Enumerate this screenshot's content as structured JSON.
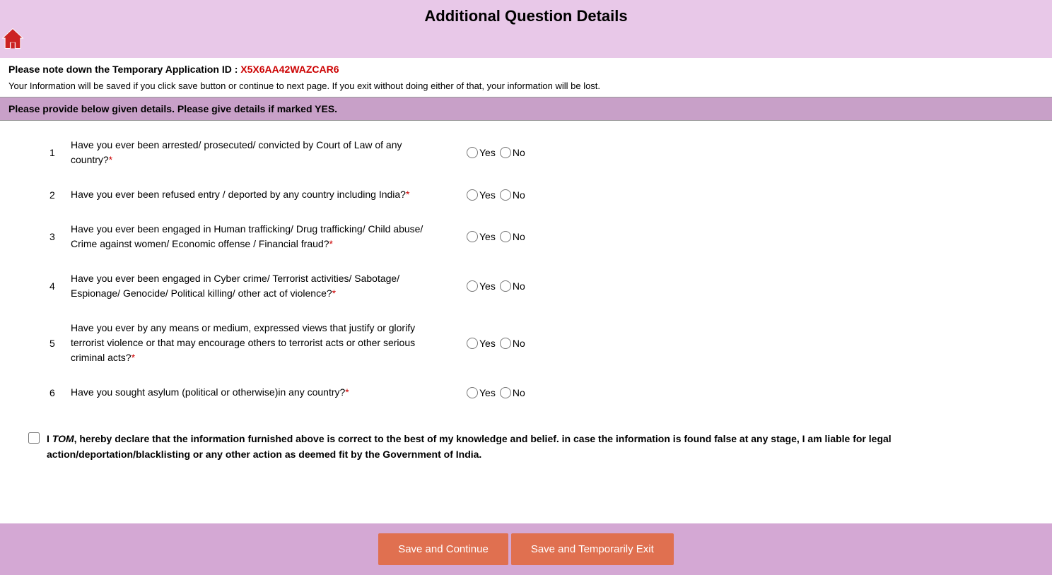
{
  "header": {
    "title": "Additional Question Details",
    "home_icon_label": "home"
  },
  "app_id_section": {
    "label": "Please note down the Temporary Application ID :",
    "value": "X5X6AA42WAZCAR6"
  },
  "info_text": "Your Information will be saved if you click save button or continue to next page. If you exit without doing either of that, your information will be lost.",
  "section_header": "Please provide below given details. Please give details if marked YES.",
  "questions": [
    {
      "number": "1",
      "text": "Have you ever been arrested/ prosecuted/ convicted by Court of Law of any country?",
      "required": true,
      "yes_label": "Yes",
      "no_label": "No",
      "name": "q1"
    },
    {
      "number": "2",
      "text": "Have you ever been refused entry / deported by any country including India?",
      "required": true,
      "yes_label": "Yes",
      "no_label": "No",
      "name": "q2"
    },
    {
      "number": "3",
      "text": "Have you ever been engaged in Human trafficking/ Drug trafficking/ Child abuse/ Crime against women/ Economic offense / Financial fraud?",
      "required": true,
      "yes_label": "Yes",
      "no_label": "No",
      "name": "q3"
    },
    {
      "number": "4",
      "text": "Have you ever been engaged in Cyber crime/ Terrorist activities/ Sabotage/ Espionage/ Genocide/ Political killing/ other act of violence?",
      "required": true,
      "yes_label": "Yes",
      "no_label": "No",
      "name": "q4"
    },
    {
      "number": "5",
      "text": "Have you ever by any means or medium, expressed views that justify or glorify terrorist violence or that may encourage others to terrorist acts or other serious criminal acts?",
      "required": true,
      "yes_label": "Yes",
      "no_label": "No",
      "name": "q5"
    },
    {
      "number": "6",
      "text": "Have you sought asylum (political or otherwise)in any country?",
      "required": true,
      "yes_label": "Yes",
      "no_label": "No",
      "name": "q6"
    }
  ],
  "declaration": {
    "name": "TOM",
    "text_before_name": "I ",
    "text_after_name": ", hereby declare that the information furnished above is correct to the best of my knowledge and belief. in case the information is found false at any stage, I am liable for legal action/deportation/blacklisting or any other action as deemed fit by the Government of India."
  },
  "buttons": {
    "save_continue": "Save and Continue",
    "save_exit": "Save and Temporarily Exit"
  },
  "colors": {
    "header_bg": "#e8c8e8",
    "section_header_bg": "#c8a0c8",
    "footer_bg": "#d4a8d4",
    "button_bg": "#e07050",
    "app_id_color": "#cc0000"
  }
}
